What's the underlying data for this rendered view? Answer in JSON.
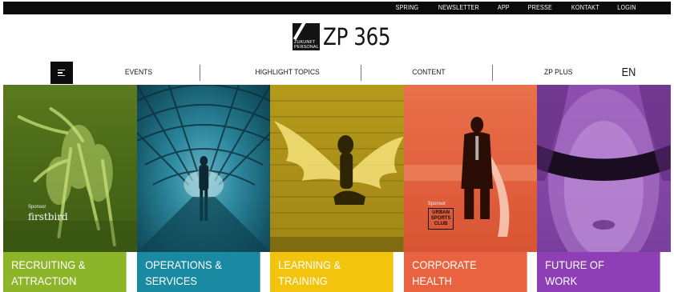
{
  "topbar": {
    "links": [
      "SPRING",
      "NEWSLETTER",
      "APP",
      "PRESSE",
      "KONTAKT",
      "LOGIN"
    ]
  },
  "logo": {
    "mark_line1": "ZUKUNFT",
    "mark_line2": "PERSONAL",
    "title": "ZP 365"
  },
  "nav": {
    "menu_icon": "hamburger-menu-icon",
    "items": [
      "EVENTS",
      "HIGHLIGHT TOPICS",
      "CONTENT",
      "ZP PLUS"
    ],
    "language": "EN"
  },
  "tiles": [
    {
      "line1": "RECRUITING &",
      "line2": "ATTRACTION",
      "color": "#8db52a",
      "sponsor_label": "Sponsor",
      "sponsor_name": "firstbird"
    },
    {
      "line1": "OPERATIONS &",
      "line2": "SERVICES",
      "color": "#1a8aa3"
    },
    {
      "line1": "LEARNING &",
      "line2": "TRAINING",
      "color": "#f2c40d"
    },
    {
      "line1": "CORPORATE",
      "line2": "HEALTH",
      "color": "#e96340",
      "sponsor_label": "Sponsor",
      "sponsor_line1": "URBAN",
      "sponsor_line2": "SPORTS",
      "sponsor_line3": "CLUB"
    },
    {
      "line1": "FUTURE OF",
      "line2": "WORK",
      "color": "#8e3fb5"
    }
  ]
}
